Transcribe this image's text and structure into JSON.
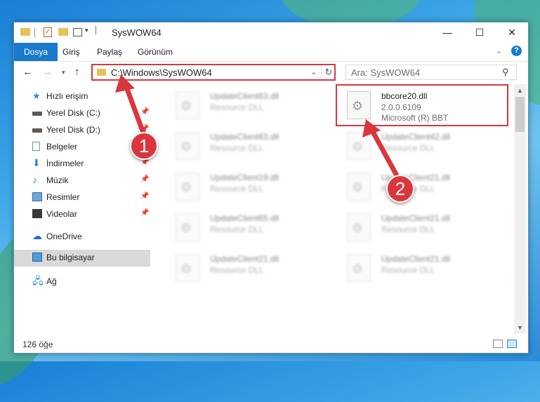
{
  "window": {
    "title": "SysWOW64",
    "controls": {
      "minimize": "—",
      "maximize": "☐",
      "close": "✕"
    }
  },
  "ribbon": {
    "tabs": [
      "Dosya",
      "Giriş",
      "Paylaş",
      "Görünüm"
    ],
    "accent": "#1979ca"
  },
  "address": {
    "path": "C:\\Windows\\SysWOW64",
    "search_placeholder": "Ara: SysWOW64"
  },
  "nav_pane": {
    "items": [
      {
        "label": "Hızlı erişim",
        "icon": "star-icon",
        "pinned": false
      },
      {
        "label": "Yerel Disk (C:)",
        "icon": "disk-icon",
        "pinned": true
      },
      {
        "label": "Yerel Disk (D:)",
        "icon": "disk-icon",
        "pinned": true
      },
      {
        "label": "Belgeler",
        "icon": "document-icon",
        "pinned": true
      },
      {
        "label": "İndirmeler",
        "icon": "download-icon",
        "pinned": true
      },
      {
        "label": "Müzik",
        "icon": "music-icon",
        "pinned": true
      },
      {
        "label": "Resimler",
        "icon": "pictures-icon",
        "pinned": true
      },
      {
        "label": "Videolar",
        "icon": "video-icon",
        "pinned": true
      },
      {
        "label": "OneDrive",
        "icon": "cloud-icon",
        "pinned": false
      },
      {
        "label": "Bu bilgisayar",
        "icon": "computer-icon",
        "pinned": false,
        "selected": true
      },
      {
        "label": "Ağ",
        "icon": "network-icon",
        "pinned": false
      }
    ]
  },
  "files": {
    "highlighted": {
      "name": "bbcore20.dll",
      "version": "2.0.0.6109",
      "company": "Microsoft (R) BBT"
    },
    "left_column": [
      {
        "name": "UpdateClient63.dll",
        "type": "Resource DLL"
      },
      {
        "name": "UpdateClient63.dll",
        "type": "Resource DLL"
      },
      {
        "name": "UpdateClient19.dll",
        "type": "Resource DLL"
      },
      {
        "name": "UpdateClient65.dll",
        "type": "Resource DLL"
      },
      {
        "name": "UpdateClient21.dll",
        "type": "Resource DLL"
      }
    ],
    "right_column": [
      {
        "name": "UpdateClient42.dll",
        "type": "Resource DLL"
      },
      {
        "name": "UpdateClient21.dll",
        "type": "Resource DLL"
      },
      {
        "name": "UpdateClient21.dll",
        "type": "Resource DLL"
      },
      {
        "name": "UpdateClient21.dll",
        "type": "Resource DLL"
      }
    ]
  },
  "status": {
    "count": "126 öğe"
  },
  "annotations": {
    "step1": "1",
    "step2": "2",
    "color": "#d9363e"
  }
}
